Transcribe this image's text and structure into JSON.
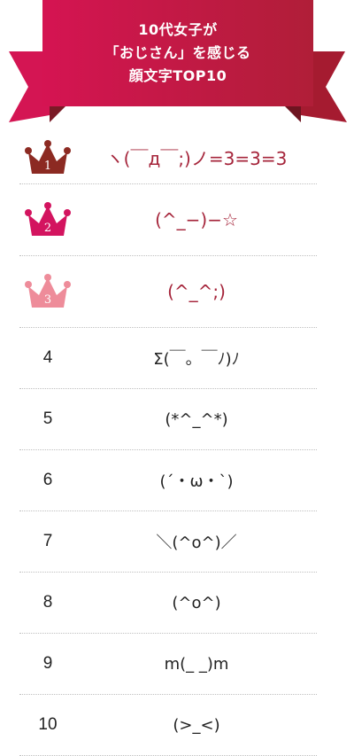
{
  "banner": {
    "line1": "10代女子が",
    "line2": "「おじさん」を感じる",
    "line3": "顔文字TOP10"
  },
  "colors": {
    "banner_main": "#c41e4a",
    "banner_dark": "#7e1526",
    "gold_rank": "#8c2a22",
    "silver_rank": "#d3145f",
    "bronze_rank": "#ee8c9a",
    "emoticon_top": "#a5243a"
  },
  "ranking": [
    {
      "rank": "1",
      "emoticon": "ヽ(￣д￣;)ノ=3=3=3"
    },
    {
      "rank": "2",
      "emoticon": "(^_−)−☆"
    },
    {
      "rank": "3",
      "emoticon": "(^_^;)"
    },
    {
      "rank": "4",
      "emoticon": "Σ(￣。￣ﾉ)ﾉ"
    },
    {
      "rank": "5",
      "emoticon": "(*^_^*)"
    },
    {
      "rank": "6",
      "emoticon": "(´・ω・`)"
    },
    {
      "rank": "7",
      "emoticon": "＼(^o^)／"
    },
    {
      "rank": "8",
      "emoticon": "(^o^)"
    },
    {
      "rank": "9",
      "emoticon": "m(_ _)m"
    },
    {
      "rank": "10",
      "emoticon": "(>_<)"
    }
  ]
}
